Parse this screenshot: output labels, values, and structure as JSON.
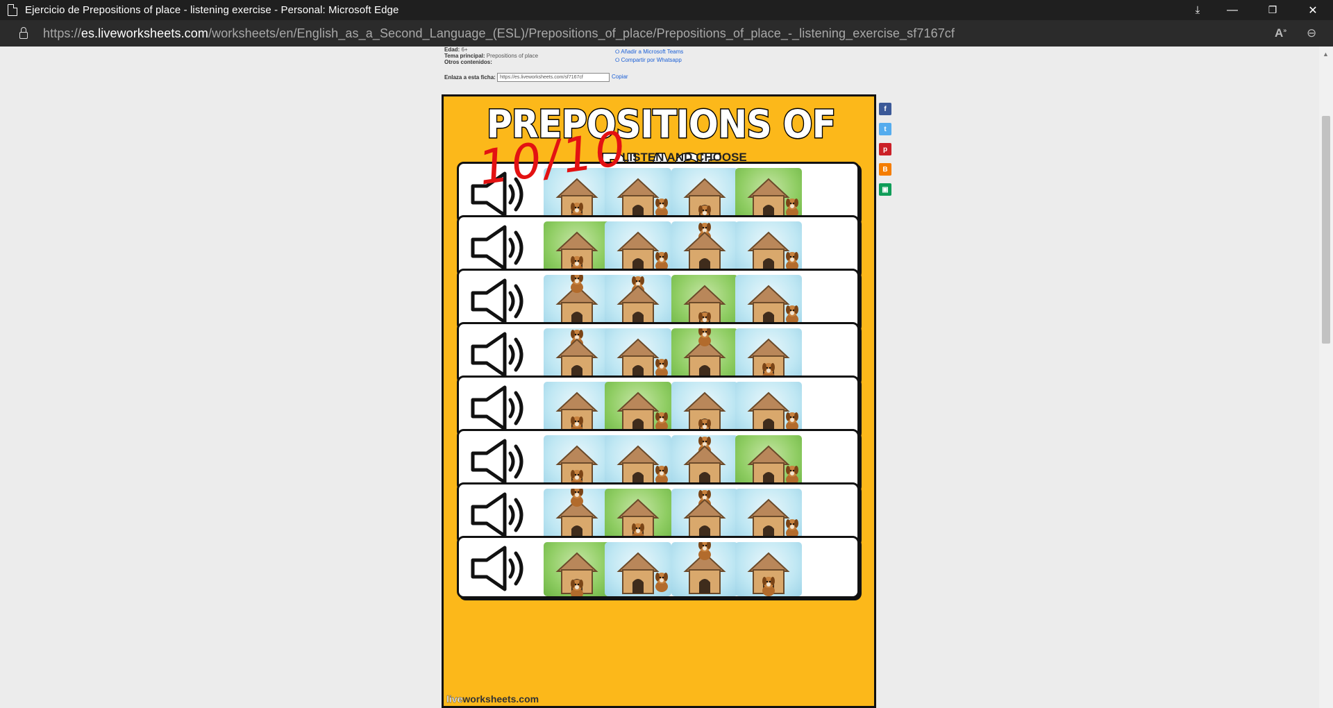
{
  "window": {
    "title": "Ejercicio de Prepositions of place - listening exercise - Personal: Microsoft Edge",
    "minimize": "—",
    "restore": "❐",
    "close": "✕"
  },
  "address": {
    "scheme": "https://",
    "host": "es.liveworksheets.com",
    "path": "/worksheets/en/English_as_a_Second_Language_(ESL)/Prepositions_of_place/Prepositions_of_place_-_listening_exercise_sf7167cf"
  },
  "info": {
    "edad_label": "Edad:",
    "edad_value": "6+",
    "tema_label": "Tema principal:",
    "tema_value": "Prepositions of place",
    "otros_label": "Otros contenidos:",
    "teams_link": "Añadir a Microsoft Teams",
    "whatsapp_link": "Compartir por Whatsapp",
    "enlaza_label": "Enlaza a esta ficha:",
    "link_value": "https://es.liveworksheets.com/sf7167cf",
    "copy_label": "Copiar"
  },
  "worksheet": {
    "title": "PREPOSITIONS OF PLACE",
    "subtitle": "LISTEN AND CHOOSE",
    "score": "10/10",
    "footer_brand_light": "live",
    "footer_brand": "worksheets.com",
    "rows": [
      {
        "options": [
          "in",
          "next-to",
          "in-front",
          "next-to"
        ],
        "selected": 3
      },
      {
        "options": [
          "in",
          "next-to",
          "behind",
          "next-to"
        ],
        "selected": 0
      },
      {
        "options": [
          "on",
          "behind",
          "in-front",
          "next-to"
        ],
        "selected": 2
      },
      {
        "options": [
          "behind",
          "next-to",
          "on",
          "in"
        ],
        "selected": 2
      },
      {
        "options": [
          "in",
          "next-to",
          "in-front",
          "next-to"
        ],
        "selected": 1
      },
      {
        "options": [
          "in",
          "next-to",
          "behind",
          "next-to"
        ],
        "selected": 3
      },
      {
        "options": [
          "on",
          "in",
          "behind",
          "next-to"
        ],
        "selected": 1
      },
      {
        "options": [
          "in-front",
          "next-to",
          "on",
          "in"
        ],
        "selected": 0
      }
    ]
  },
  "social": [
    {
      "name": "facebook",
      "glyph": "f",
      "color": "#3b5998"
    },
    {
      "name": "twitter",
      "glyph": "t",
      "color": "#55acee"
    },
    {
      "name": "pinterest",
      "glyph": "p",
      "color": "#cb2027"
    },
    {
      "name": "blogger",
      "glyph": "B",
      "color": "#f57d00"
    },
    {
      "name": "classroom",
      "glyph": "▣",
      "color": "#0f9d58"
    }
  ]
}
